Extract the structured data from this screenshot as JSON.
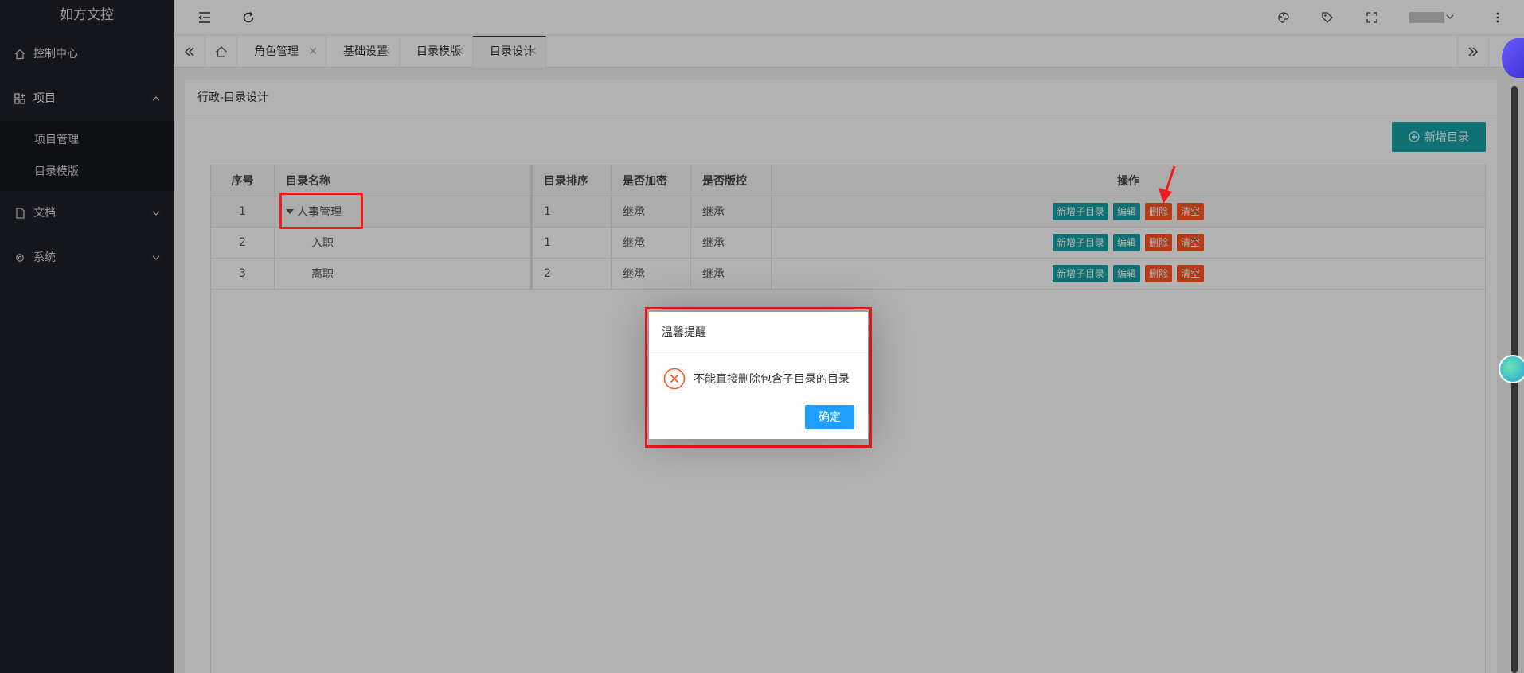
{
  "app": {
    "title": "如方文控"
  },
  "sidebar": {
    "items": [
      {
        "label": "控制中心",
        "icon": "home-icon"
      },
      {
        "label": "项目",
        "icon": "grid-icon",
        "expanded": true,
        "children": [
          {
            "label": "项目管理"
          },
          {
            "label": "目录模版"
          }
        ]
      },
      {
        "label": "文档",
        "icon": "file-icon"
      },
      {
        "label": "系统",
        "icon": "gear-icon"
      }
    ]
  },
  "tabs": [
    {
      "label": "角色管理"
    },
    {
      "label": "基础设置"
    },
    {
      "label": "目录模版"
    },
    {
      "label": "目录设计",
      "active": true
    }
  ],
  "page": {
    "breadcrumb": "行政-目录设计",
    "add_button": "新增目录"
  },
  "table": {
    "headers": [
      "序号",
      "目录名称",
      "目录排序",
      "是否加密",
      "是否版控",
      "操作"
    ],
    "rows": [
      {
        "no": "1",
        "name": "人事管理",
        "order": "1",
        "encrypt": "继承",
        "version": "继承"
      },
      {
        "no": "2",
        "name": "入职",
        "order": "1",
        "encrypt": "继承",
        "version": "继承"
      },
      {
        "no": "3",
        "name": "离职",
        "order": "2",
        "encrypt": "继承",
        "version": "继承"
      }
    ],
    "actions": {
      "add_child": "新增子目录",
      "edit": "编辑",
      "delete": "删除",
      "clear": "清空"
    }
  },
  "dialog": {
    "title": "温馨提醒",
    "message": "不能直接删除包含子目录的目录",
    "ok": "确定",
    "icon": "error-circle-icon"
  },
  "colors": {
    "sidebar_bg": "#20222a",
    "teal": "#16a2a5",
    "orange": "#ff5722",
    "blue": "#1e9fff",
    "annotation_red": "#ee1c1c"
  }
}
